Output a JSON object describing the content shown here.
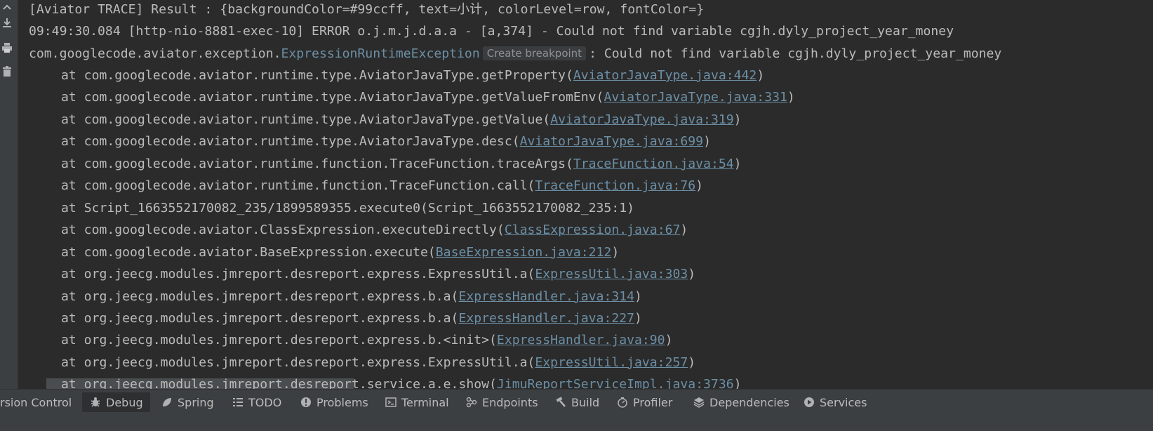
{
  "console": {
    "lines": [
      "[Aviator TRACE] Result : {backgroundColor=#99ccff, text=小计, colorLevel=row, fontColor=}",
      "09:49:30.084 [http-nio-8881-exec-10] ERROR o.j.m.j.d.a.a - [a,374] - Could not find variable cgjh.dyly_project_year_money"
    ],
    "exception": {
      "prefix": "com.googlecode.aviator.exception.",
      "class_link": "ExpressionRuntimeException",
      "breakpoint_label": "Create breakpoint",
      "suffix": ": Could not find variable cgjh.dyly_project_year_money"
    },
    "stack": [
      {
        "prefix": "at com.googlecode.aviator.runtime.type.AviatorJavaType.getProperty(",
        "link": "AviatorJavaType.java:442",
        "suffix": ")"
      },
      {
        "prefix": "at com.googlecode.aviator.runtime.type.AviatorJavaType.getValueFromEnv(",
        "link": "AviatorJavaType.java:331",
        "suffix": ")"
      },
      {
        "prefix": "at com.googlecode.aviator.runtime.type.AviatorJavaType.getValue(",
        "link": "AviatorJavaType.java:319",
        "suffix": ")"
      },
      {
        "prefix": "at com.googlecode.aviator.runtime.type.AviatorJavaType.desc(",
        "link": "AviatorJavaType.java:699",
        "suffix": ")"
      },
      {
        "prefix": "at com.googlecode.aviator.runtime.function.TraceFunction.traceArgs(",
        "link": "TraceFunction.java:54",
        "suffix": ")"
      },
      {
        "prefix": "at com.googlecode.aviator.runtime.function.TraceFunction.call(",
        "link": "TraceFunction.java:76",
        "suffix": ")"
      },
      {
        "prefix": "at Script_1663552170082_235/1899589355.execute0(Script_1663552170082_235:1)",
        "link": "",
        "suffix": ""
      },
      {
        "prefix": "at com.googlecode.aviator.ClassExpression.executeDirectly(",
        "link": "ClassExpression.java:67",
        "suffix": ")"
      },
      {
        "prefix": "at com.googlecode.aviator.BaseExpression.execute(",
        "link": "BaseExpression.java:212",
        "suffix": ")"
      },
      {
        "prefix": "at org.jeecg.modules.jmreport.desreport.express.ExpressUtil.a(",
        "link": "ExpressUtil.java:303",
        "suffix": ")"
      },
      {
        "prefix": "at org.jeecg.modules.jmreport.desreport.express.b.a(",
        "link": "ExpressHandler.java:314",
        "suffix": ")"
      },
      {
        "prefix": "at org.jeecg.modules.jmreport.desreport.express.b.a(",
        "link": "ExpressHandler.java:227",
        "suffix": ")"
      },
      {
        "prefix": "at org.jeecg.modules.jmreport.desreport.express.b.<init>(",
        "link": "ExpressHandler.java:90",
        "suffix": ")"
      },
      {
        "prefix": "at org.jeecg.modules.jmreport.desreport.express.ExpressUtil.a(",
        "link": "ExpressUtil.java:257",
        "suffix": ")"
      },
      {
        "prefix": "at org.jeecg.modules.jmreport.desreport.service.a.e.show(",
        "link": "JimuReportServiceImpl.java:3736",
        "suffix": ")"
      }
    ]
  },
  "gutter_icons": [
    "up-arrow-icon",
    "download-icon",
    "print-icon",
    "trash-icon"
  ],
  "status_bar": {
    "tabs": [
      {
        "label": "rsion Control",
        "icon": "",
        "active": false
      },
      {
        "label": "Debug",
        "icon": "bug-icon",
        "active": true
      },
      {
        "label": "Spring",
        "icon": "spring-leaf-icon",
        "active": false
      },
      {
        "label": "TODO",
        "icon": "list-icon",
        "active": false
      },
      {
        "label": "Problems",
        "icon": "warning-icon",
        "active": false
      },
      {
        "label": "Terminal",
        "icon": "terminal-icon",
        "active": false
      },
      {
        "label": "Endpoints",
        "icon": "endpoints-icon",
        "active": false
      },
      {
        "label": "Build",
        "icon": "hammer-icon",
        "active": false
      },
      {
        "label": "Profiler",
        "icon": "profiler-icon",
        "active": false
      },
      {
        "label": "Dependencies",
        "icon": "layers-icon",
        "active": false
      },
      {
        "label": "Services",
        "icon": "play-icon",
        "active": false
      }
    ]
  },
  "colors": {
    "console_bg": "#2b2b2b",
    "text": "#bbbbbb",
    "link": "#6c8fa6",
    "panel": "#3c3f41"
  }
}
